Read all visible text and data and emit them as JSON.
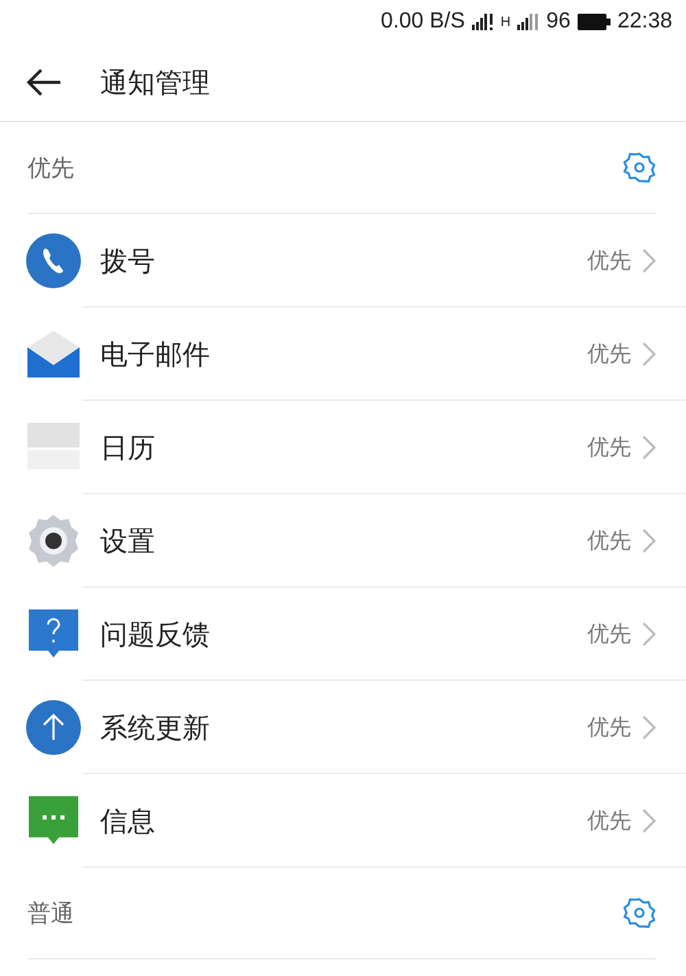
{
  "status_bar": {
    "speed": "0.00 B/S",
    "network": "H",
    "battery": "96",
    "time": "22:38"
  },
  "header": {
    "title": "通知管理"
  },
  "sections": [
    {
      "title": "优先",
      "items": [
        {
          "kind": "phone",
          "name": "拨号",
          "level_text": "优先"
        },
        {
          "kind": "mail",
          "name": "电子邮件",
          "level_text": "优先"
        },
        {
          "kind": "calendar",
          "name": "日历",
          "level_text": "优先"
        },
        {
          "kind": "gear",
          "name": "设置",
          "level_text": "优先"
        },
        {
          "kind": "feedback",
          "name": "问题反馈",
          "level_text": "优先"
        },
        {
          "kind": "update",
          "name": "系统更新",
          "level_text": "优先"
        },
        {
          "kind": "message",
          "name": "信息",
          "level_text": "优先"
        }
      ]
    },
    {
      "title": "普通"
    }
  ]
}
